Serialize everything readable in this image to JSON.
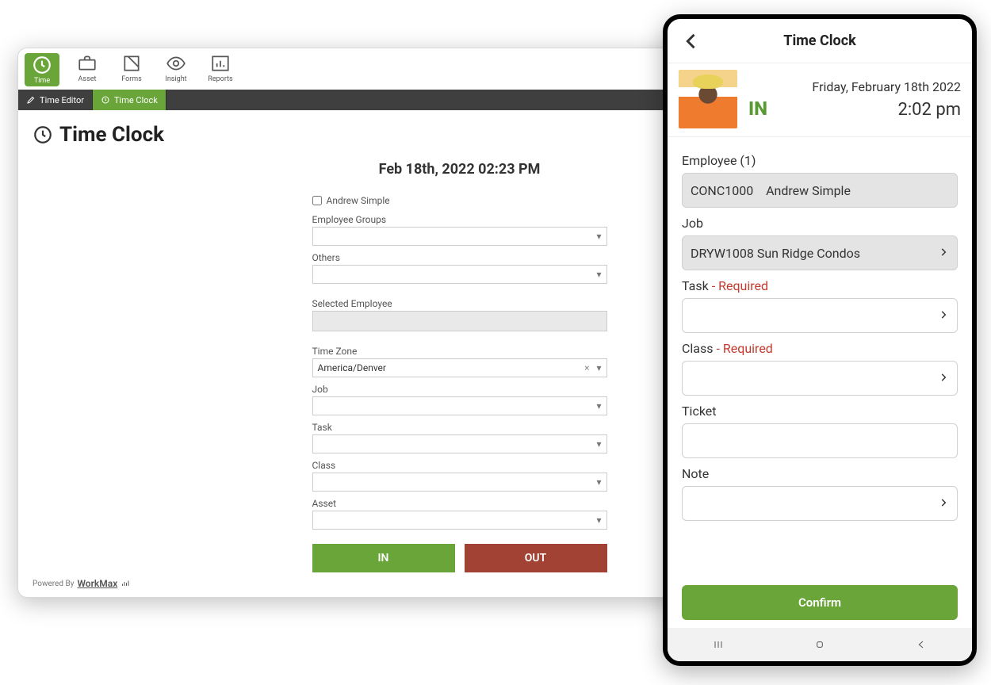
{
  "modules": {
    "time": {
      "label": "Time"
    },
    "asset": {
      "label": "Asset"
    },
    "forms": {
      "label": "Forms"
    },
    "insight": {
      "label": "Insight"
    },
    "reports": {
      "label": "Reports"
    }
  },
  "subnav": {
    "time_editor": "Time Editor",
    "time_clock": "Time Clock"
  },
  "page": {
    "title": "Time Clock",
    "datetime": "Feb 18th, 2022 02:23 PM",
    "employee_checkbox_label": "Andrew Simple",
    "labels": {
      "employee_groups": "Employee Groups",
      "others": "Others",
      "selected_employee": "Selected Employee",
      "time_zone": "Time Zone",
      "job": "Job",
      "task": "Task",
      "class": "Class",
      "asset": "Asset"
    },
    "values": {
      "time_zone": "America/Denver"
    },
    "buttons": {
      "in": "IN",
      "out": "OUT"
    },
    "powered_prefix": "Powered By",
    "powered_brand": "WorkMax"
  },
  "mobile": {
    "title": "Time Clock",
    "date": "Friday, February 18th 2022",
    "status": "IN",
    "time": "2:02 pm",
    "labels": {
      "employee": "Employee (1)",
      "job": "Job",
      "task": "Task",
      "task_req": " - Required",
      "class": "Class",
      "class_req": " - Required",
      "ticket": "Ticket",
      "note": "Note"
    },
    "values": {
      "employee_code": "CONC1000",
      "employee_name": "Andrew Simple",
      "job": "DRYW1008 Sun Ridge Condos"
    },
    "confirm": "Confirm"
  }
}
